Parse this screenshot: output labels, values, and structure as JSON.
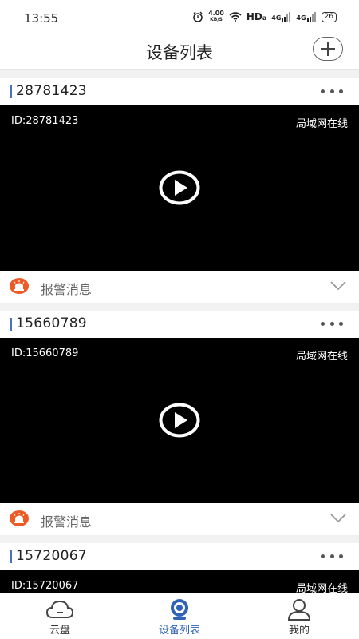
{
  "status_bar": {
    "time": "13:55",
    "net_speed": "4.00",
    "net_unit": "KB/S",
    "hd": "HD",
    "hd_sub": "a",
    "sig1": "4G",
    "sig2": "4G",
    "battery": "26"
  },
  "header": {
    "title": "设备列表"
  },
  "devices": [
    {
      "name": "28781423",
      "overlay_id": "ID:28781423",
      "status": "局域网在线",
      "alarm_label": "报警消息"
    },
    {
      "name": "15660789",
      "overlay_id": "ID:15660789",
      "status": "局域网在线",
      "alarm_label": "报警消息"
    },
    {
      "name": "15720067",
      "overlay_id": "ID:15720067",
      "status": "局域网在线"
    }
  ],
  "tabs": [
    {
      "label": "云盘",
      "icon": "cloud-icon"
    },
    {
      "label": "设备列表",
      "icon": "camera-icon",
      "active": true
    },
    {
      "label": "我的",
      "icon": "user-icon"
    }
  ],
  "colors": {
    "accent": "#4a72c0",
    "active_tab": "#2f63b5",
    "alarm": "#ee5a24"
  }
}
